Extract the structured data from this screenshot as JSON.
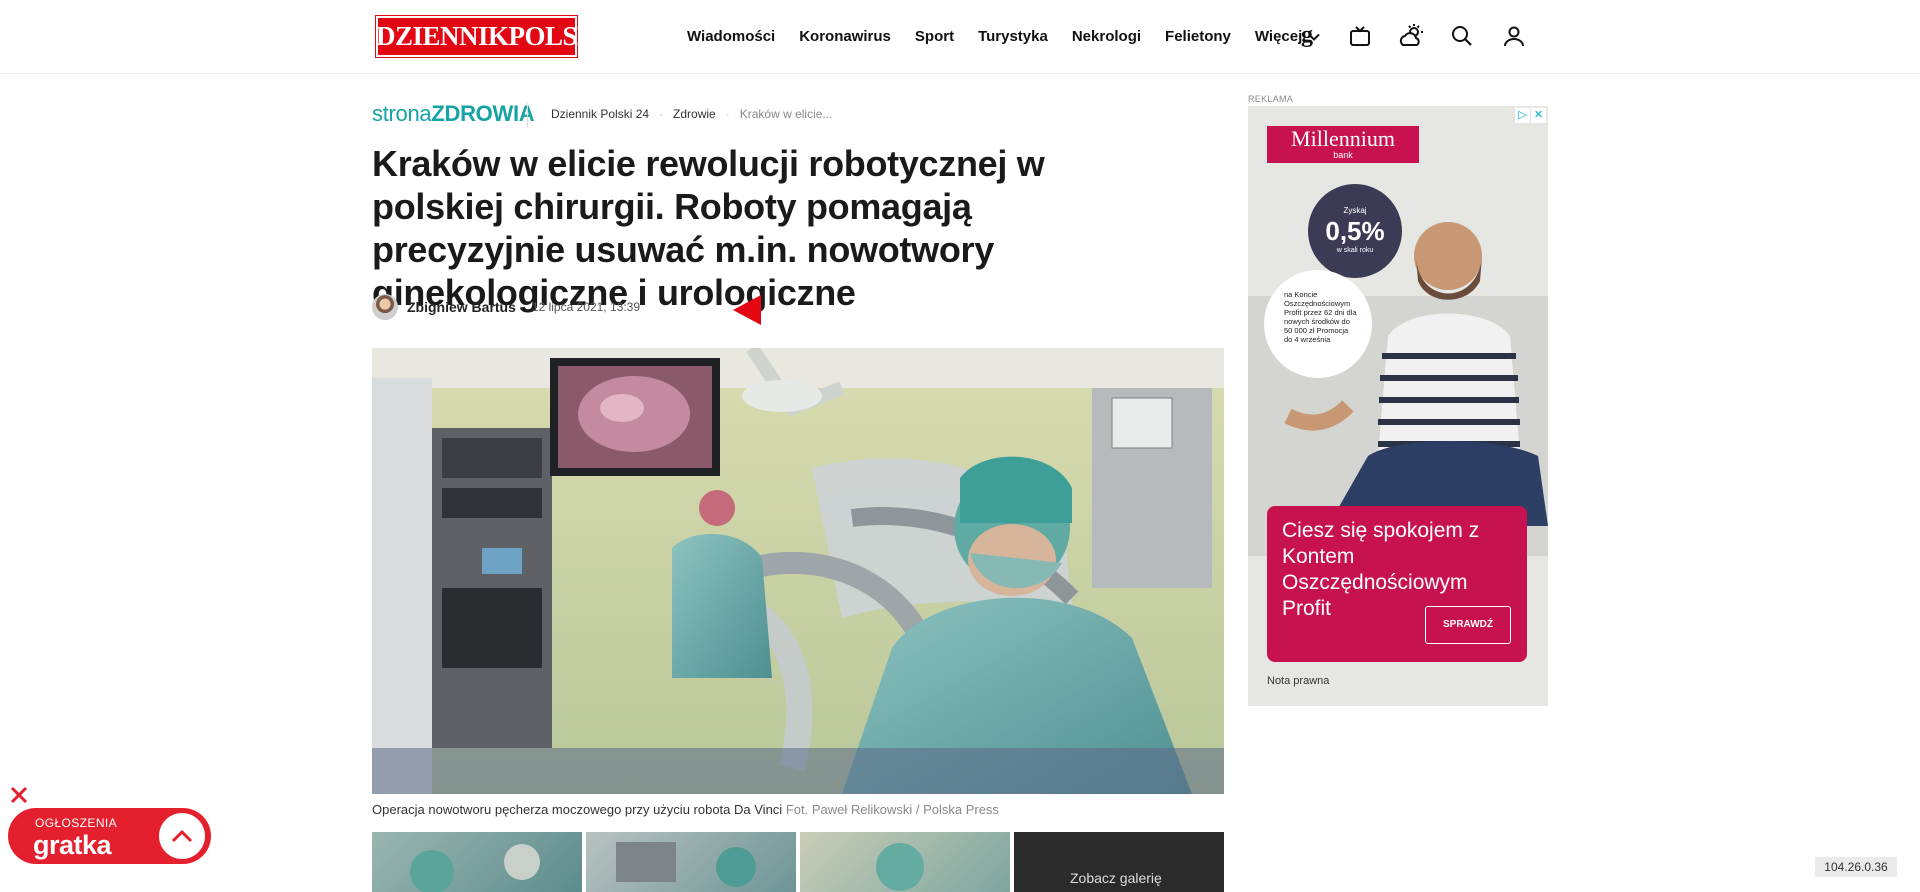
{
  "header": {
    "logo_text": "DZIENNIKPOLSKI",
    "nav": [
      "Wiadomości",
      "Koronawirus",
      "Sport",
      "Turystyka",
      "Nekrologi",
      "Felietony"
    ],
    "nav_more": "Więcej",
    "icons": [
      "gratka-g-icon",
      "tv-icon",
      "weather-icon",
      "search-icon",
      "user-icon"
    ]
  },
  "section": {
    "brand_part1": "strona",
    "brand_part2": "ZDROWIA"
  },
  "breadcrumb": [
    "Dziennik Polski 24",
    "Zdrowie",
    "Kraków w elicie..."
  ],
  "article": {
    "title": "Kraków w elicie rewolucji robotycznej w polskiej chirurgii. Roboty pomagają precyzyjnie usuwać m.in. nowotwory ginekologiczne i urologiczne",
    "author": "Zbigniew Bartuś",
    "date": "12 lipca 2021, 13:39",
    "caption": "Operacja nowotworu pęcherza moczowego przy użyciu robota Da Vinci",
    "caption_credit": "Fot. Paweł Relikowski / Polska Press",
    "gallery_label": "Zobacz galerię"
  },
  "ad": {
    "label": "REKLAMA",
    "brand": "Millennium",
    "brand_sub": "bank",
    "rate_top": "Zyskaj",
    "rate": "0,5%",
    "rate_sub": "w skali roku",
    "info": "na Koncie Oszczędnościowym Profit przez 62 dni dla nowych środków do 50 000 zł Promocja do 4 września",
    "headline": "Ciesz się spokojem z Kontem Oszczędnościowym Profit",
    "cta": "SPRAWDŹ",
    "legal": "Nota prawna",
    "colors": {
      "brand": "#c8124f",
      "bubble": "#3b3b56"
    }
  },
  "widget": {
    "label_top": "OGŁOSZENIA",
    "label_brand": "gratka"
  },
  "ip": "104.26.0.36",
  "colors": {
    "accent": "#e30613",
    "zdrowia": "#16a3a3"
  }
}
